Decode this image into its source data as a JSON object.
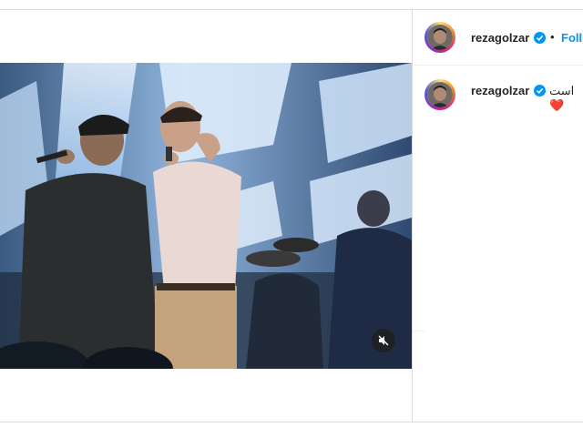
{
  "post": {
    "username": "rezagolzar",
    "separator": "•",
    "follow_label": "Foll",
    "caption": "است❤️"
  },
  "icons": {
    "verified": "verified-badge-icon",
    "mute": "speaker-muted-icon"
  },
  "colors": {
    "link": "#0095f6",
    "verified": "#0095f6",
    "border": "#dbdbdb"
  }
}
